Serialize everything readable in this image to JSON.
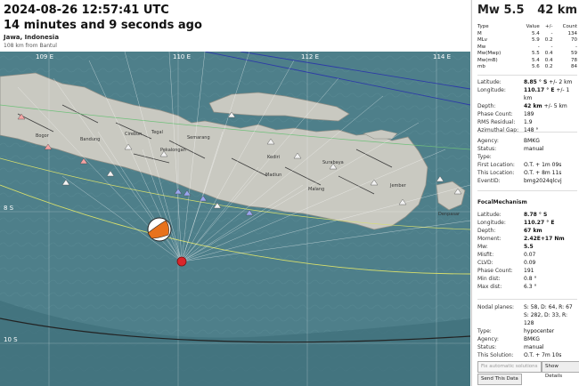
{
  "header": {
    "time": "2024-08-26 12:57:41 UTC",
    "ago": "14 minutes and 9 seconds ago",
    "region": "Jawa, Indonesia",
    "distance": "108 km from Bantul"
  },
  "map": {
    "lon_labels": [
      "109 E",
      "110 E",
      "112 E",
      "114 E"
    ],
    "lat_labels": [
      "8 S",
      "10 S"
    ],
    "place_labels": [
      "Bandung",
      "Semarang",
      "Madiun",
      "Surabaya",
      "Jember",
      "Malang",
      "Denpasar",
      "Cirebon",
      "Bogor",
      "Tegal",
      "Kediri",
      "Pekalongan"
    ],
    "colors": {
      "sea": "#4e7f8a",
      "land": "#c9c9c1",
      "epicenter": "#d9262b",
      "station_ok": "#f3f3f3",
      "station_blue": "#9aa6f0",
      "station_red": "#f4a3a3"
    }
  },
  "panel": {
    "magnitude": "Mw 5.5",
    "depth": "42 km",
    "mag_table": {
      "headers": [
        "Type",
        "Value",
        "+/-",
        "Count"
      ],
      "rows": [
        [
          "M",
          "5.4",
          "-",
          "134"
        ],
        [
          "MLv",
          "5.9",
          "0.2",
          "70"
        ],
        [
          "Mw",
          "-",
          "-",
          "-"
        ],
        [
          "Mw(Mwp)",
          "5.5",
          "0.4",
          "59"
        ],
        [
          "Mw(mB)",
          "5.4",
          "0.4",
          "78"
        ],
        [
          "mb",
          "5.6",
          "0.2",
          "84"
        ]
      ]
    },
    "origin": [
      {
        "k": "Latitude:",
        "v": "8.85 ° S",
        "e": "+/-  2 km",
        "bold": true
      },
      {
        "k": "Longitude:",
        "v": "110.17 ° E",
        "e": "+/-  1 km",
        "bold": true
      },
      {
        "k": "Depth:",
        "v": "42 km",
        "e": "+/-  5 km",
        "bold": true
      },
      {
        "k": "Phase Count:",
        "v": "189",
        "e": ""
      },
      {
        "k": "RMS Residual:",
        "v": "1.9",
        "e": ""
      },
      {
        "k": "Azimuthal Gap:",
        "v": "148 °",
        "e": ""
      }
    ],
    "agency": [
      {
        "k": "Agency:",
        "v": "BMKG"
      },
      {
        "k": "Status:",
        "v": "manual"
      },
      {
        "k": "Type:",
        "v": ""
      },
      {
        "k": "First Location:",
        "v": "O.T. + 1m 09s"
      },
      {
        "k": "This Location:",
        "v": "O.T. + 8m 11s"
      },
      {
        "k": "EventID:",
        "v": "bmg2024qlcvj"
      }
    ],
    "focal_title": "FocalMechanism",
    "focal": [
      {
        "k": "Latitude:",
        "v": "8.78 ° S",
        "bold": true
      },
      {
        "k": "Longitude:",
        "v": "110.27 ° E",
        "bold": true
      },
      {
        "k": "Depth:",
        "v": "67 km",
        "bold": true
      },
      {
        "k": "Moment:",
        "v": "2.42E+17 Nm",
        "bold": true
      },
      {
        "k": "Mw:",
        "v": "5.5",
        "bold": true
      },
      {
        "k": "Misfit:",
        "v": "0.07"
      },
      {
        "k": "CLVD:",
        "v": "0.09"
      },
      {
        "k": "Phase Count:",
        "v": "191"
      },
      {
        "k": "Min dist:",
        "v": "0.8 °"
      },
      {
        "k": "Max dist:",
        "v": "6.3 °"
      }
    ],
    "nodal": [
      {
        "k": "Nodal planes:",
        "v": "S: 58, D: 64, R: 67"
      },
      {
        "k": "",
        "v": "S: 282, D: 33, R: 128"
      },
      {
        "k": "Type:",
        "v": "hypocenter"
      },
      {
        "k": "Agency:",
        "v": "BMKG"
      },
      {
        "k": "Status:",
        "v": "manual"
      },
      {
        "k": "This Solution:",
        "v": "O.T. + 7m 10s"
      }
    ],
    "buttons": {
      "fix": "Fix automatic solutions",
      "details": "Show Details",
      "send": "Send This Data"
    }
  }
}
